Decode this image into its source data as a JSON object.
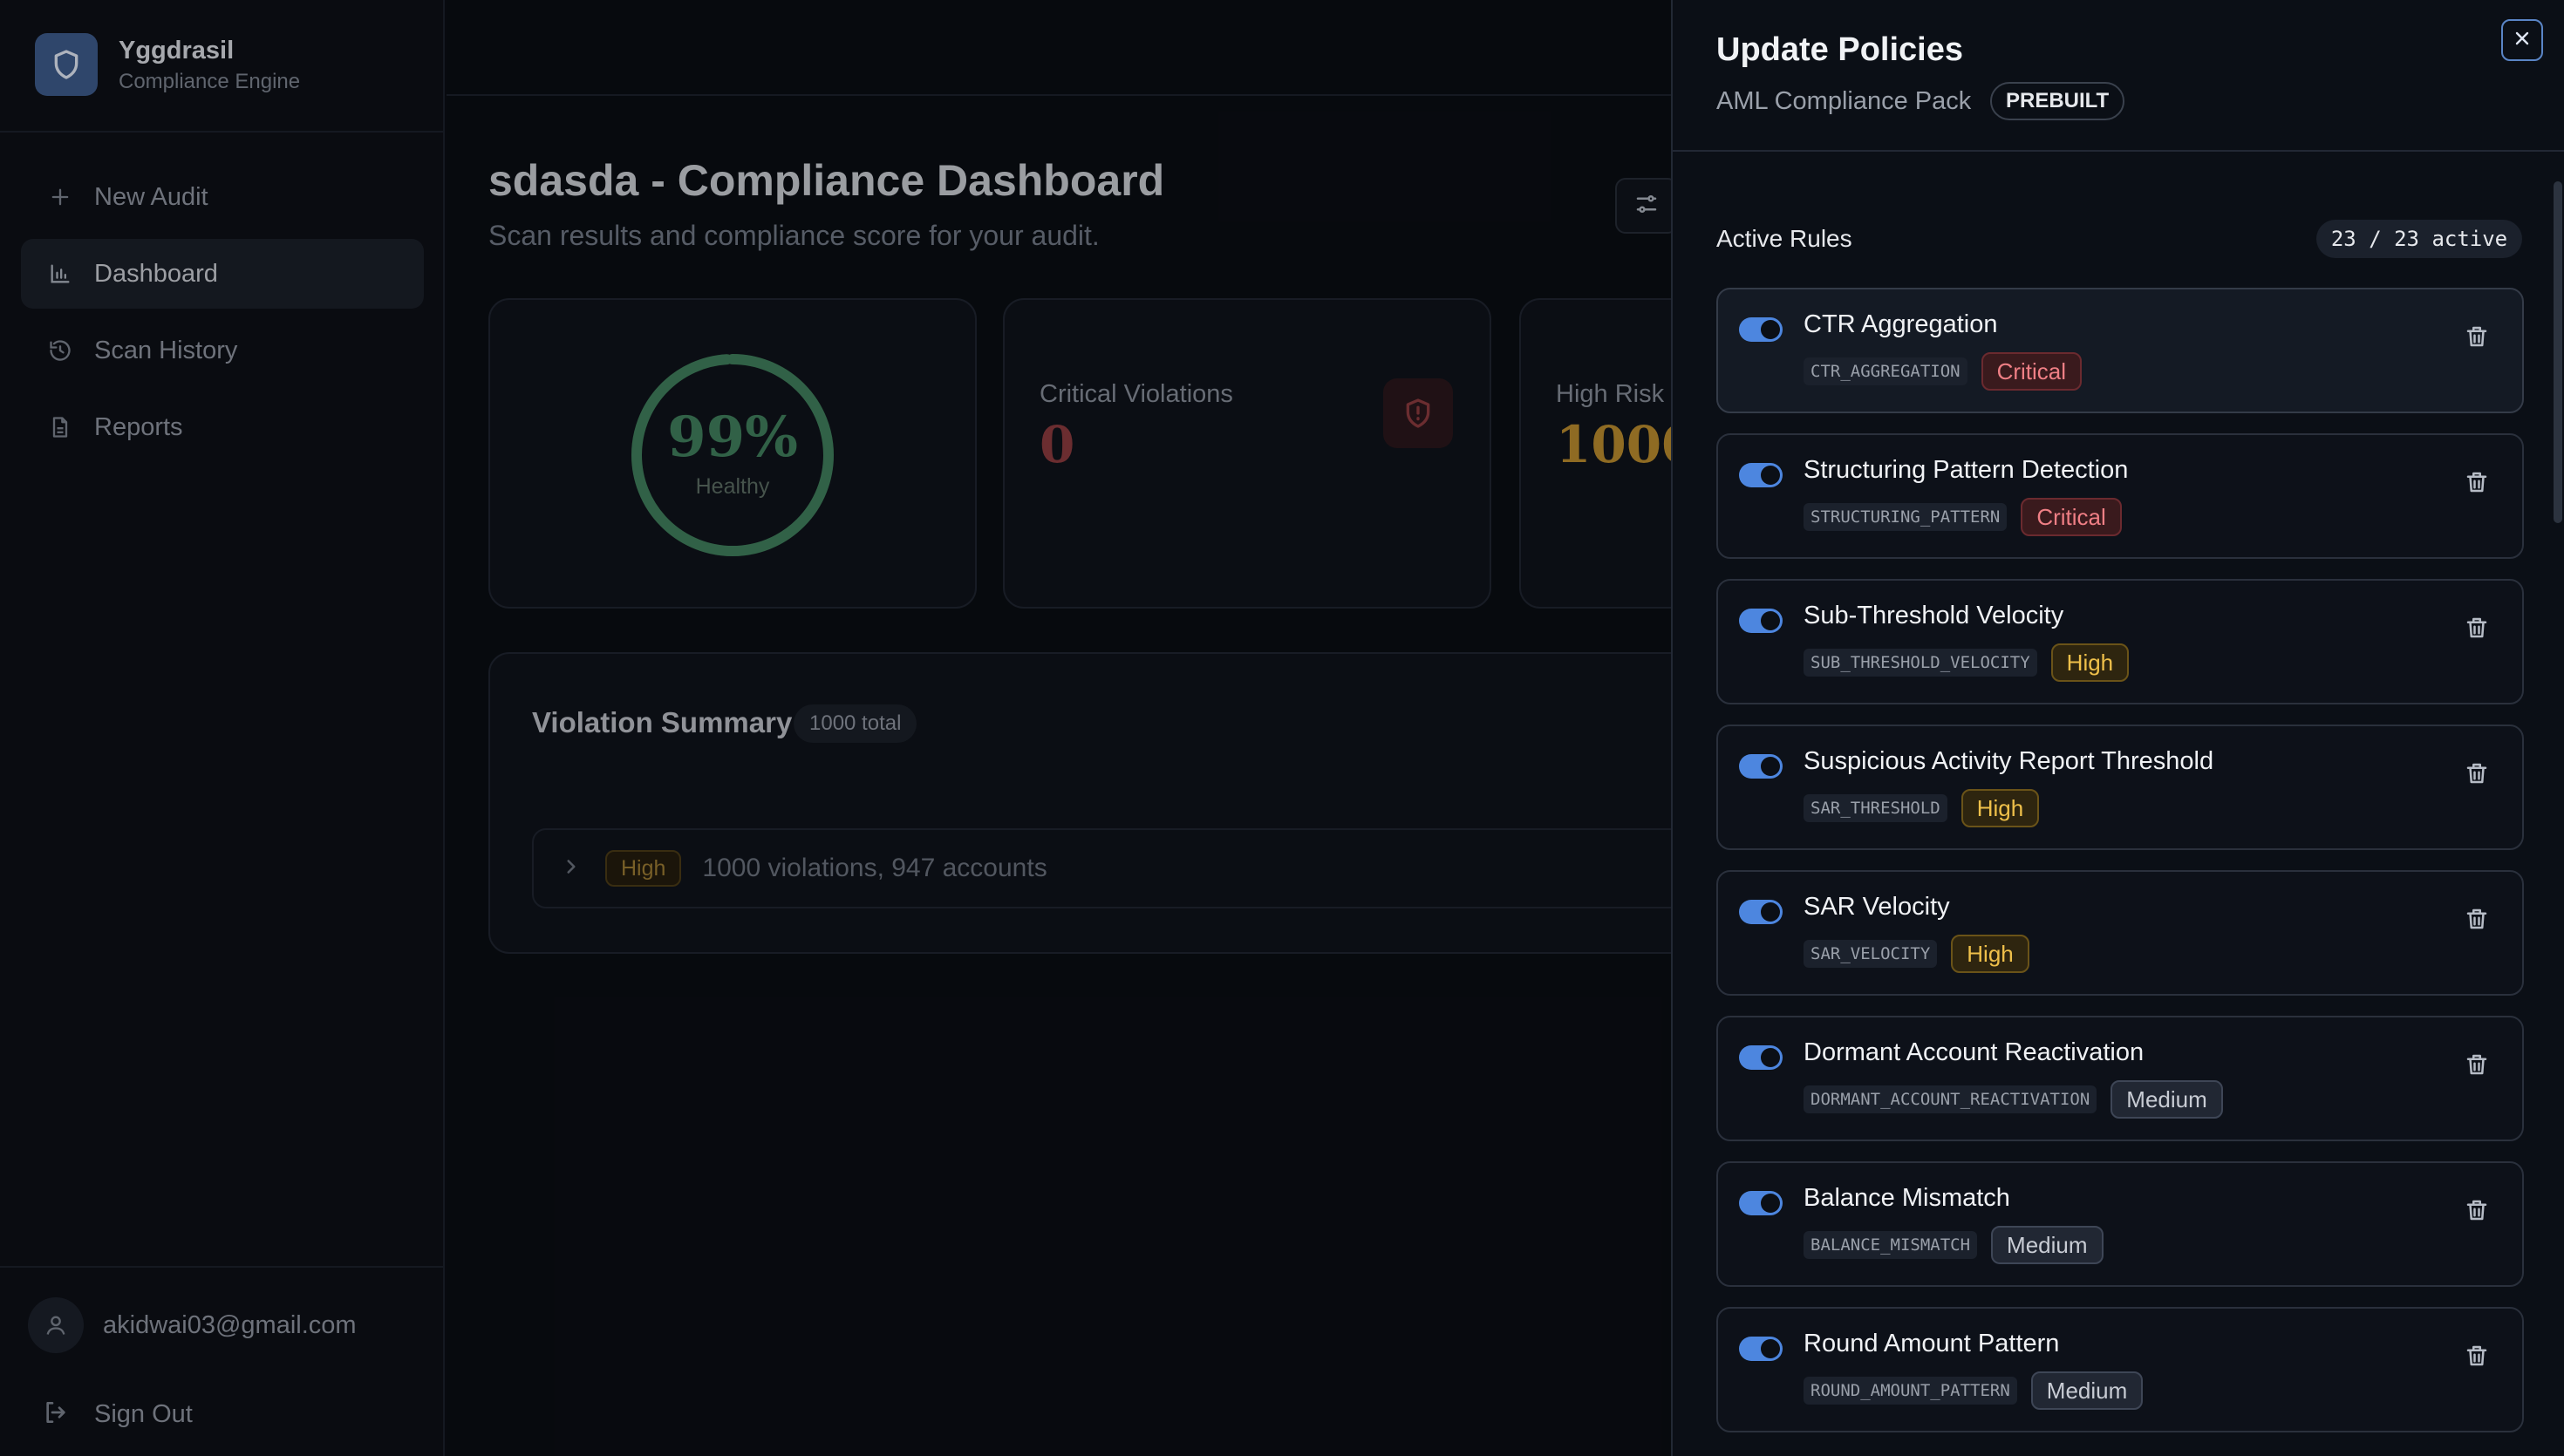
{
  "brand": {
    "name": "Yggdrasil",
    "subtitle": "Compliance Engine",
    "icon": "shield-icon"
  },
  "nav": [
    {
      "label": "New Audit",
      "icon": "plus-icon",
      "active": false
    },
    {
      "label": "Dashboard",
      "icon": "bar-chart-icon",
      "active": true
    },
    {
      "label": "Scan History",
      "icon": "history-icon",
      "active": false
    },
    {
      "label": "Reports",
      "icon": "file-icon",
      "active": false
    }
  ],
  "user": {
    "email": "akidwai03@gmail.com",
    "sign_out": "Sign Out"
  },
  "dashboard": {
    "title": "sdasda - Compliance Dashboard",
    "subtitle": "Scan results and compliance score for your audit.",
    "score": {
      "value": "99%",
      "label": "Healthy",
      "percent": 99
    },
    "critical": {
      "label": "Critical Violations",
      "value": "0"
    },
    "high_risk": {
      "label": "High Risk",
      "value": "1000"
    },
    "summary": {
      "title": "Violation Summary",
      "total": "1000 total",
      "rows": [
        {
          "severity": "High",
          "text": "1000 violations, 947 accounts"
        }
      ]
    }
  },
  "drawer": {
    "title": "Update Policies",
    "subtitle": "AML Compliance Pack",
    "tag": "PREBUILT",
    "rules_heading": "Active Rules",
    "active_count": "23 / 23 active",
    "rules": [
      {
        "name": "CTR Aggregation",
        "code": "CTR_AGGREGATION",
        "severity": "Critical",
        "enabled": true
      },
      {
        "name": "Structuring Pattern Detection",
        "code": "STRUCTURING_PATTERN",
        "severity": "Critical",
        "enabled": true
      },
      {
        "name": "Sub-Threshold Velocity",
        "code": "SUB_THRESHOLD_VELOCITY",
        "severity": "High",
        "enabled": true
      },
      {
        "name": "Suspicious Activity Report Threshold",
        "code": "SAR_THRESHOLD",
        "severity": "High",
        "enabled": true
      },
      {
        "name": "SAR Velocity",
        "code": "SAR_VELOCITY",
        "severity": "High",
        "enabled": true
      },
      {
        "name": "Dormant Account Reactivation",
        "code": "DORMANT_ACCOUNT_REACTIVATION",
        "severity": "Medium",
        "enabled": true
      },
      {
        "name": "Balance Mismatch",
        "code": "BALANCE_MISMATCH",
        "severity": "Medium",
        "enabled": true
      },
      {
        "name": "Round Amount Pattern",
        "code": "ROUND_AMOUNT_PATTERN",
        "severity": "Medium",
        "enabled": true
      }
    ]
  },
  "colors": {
    "accent": "#4d86df",
    "healthy": "#3f7d5b",
    "critical": "#ef7f85",
    "high": "#efc04a",
    "high_risk_value": "#b88a2e",
    "critical_value": "#8a3a3e"
  }
}
